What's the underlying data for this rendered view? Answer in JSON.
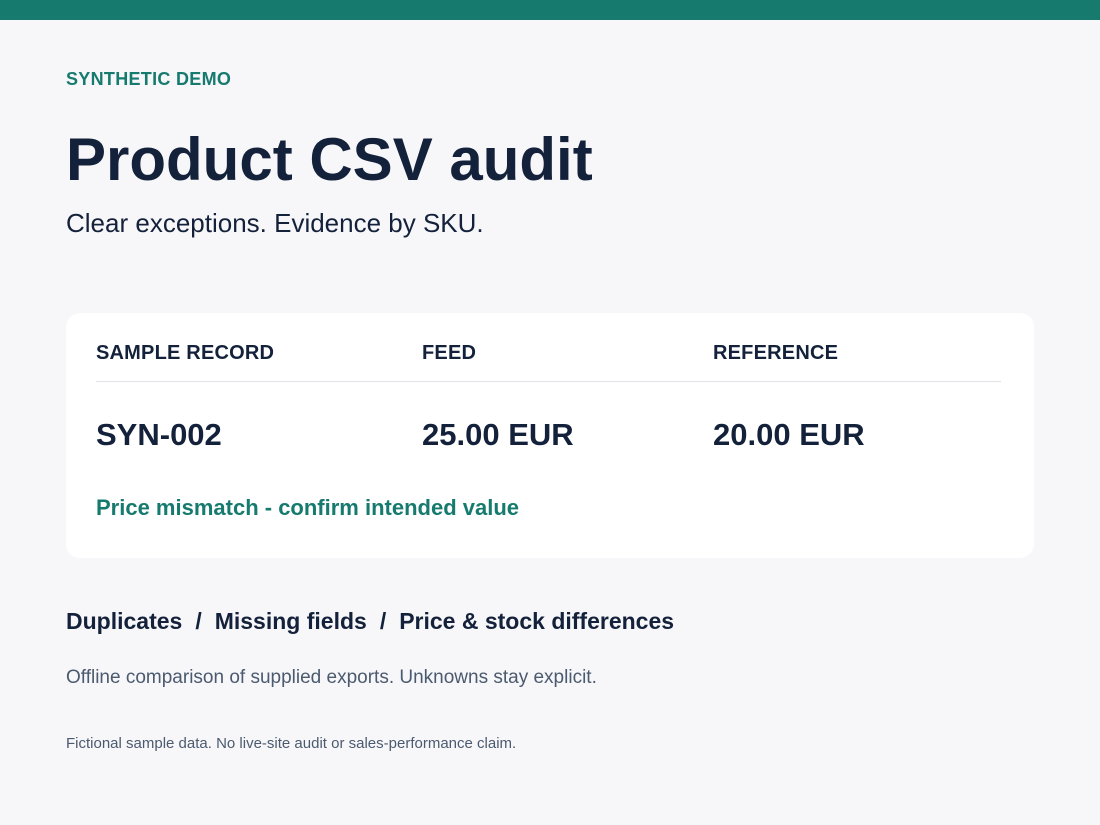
{
  "colors": {
    "accent": "#167a6e",
    "ink": "#14213a",
    "muted": "#4b5a6e",
    "background": "#f7f7fa",
    "card": "#ffffff"
  },
  "header": {
    "eyebrow": "SYNTHETIC DEMO",
    "title": "Product CSV audit",
    "subtitle": "Clear exceptions. Evidence by SKU."
  },
  "sample_card": {
    "columns": [
      "SAMPLE RECORD",
      "FEED",
      "REFERENCE"
    ],
    "row": [
      "SYN-002",
      "25.00 EUR",
      "20.00 EUR"
    ],
    "status_note": "Price mismatch - confirm intended value"
  },
  "checks": {
    "items": [
      "Duplicates",
      "Missing fields",
      "Price & stock differences"
    ],
    "separator": "/"
  },
  "description": "Offline comparison of supplied exports. Unknowns stay explicit.",
  "footnote": "Fictional sample data. No live-site audit or sales-performance claim."
}
